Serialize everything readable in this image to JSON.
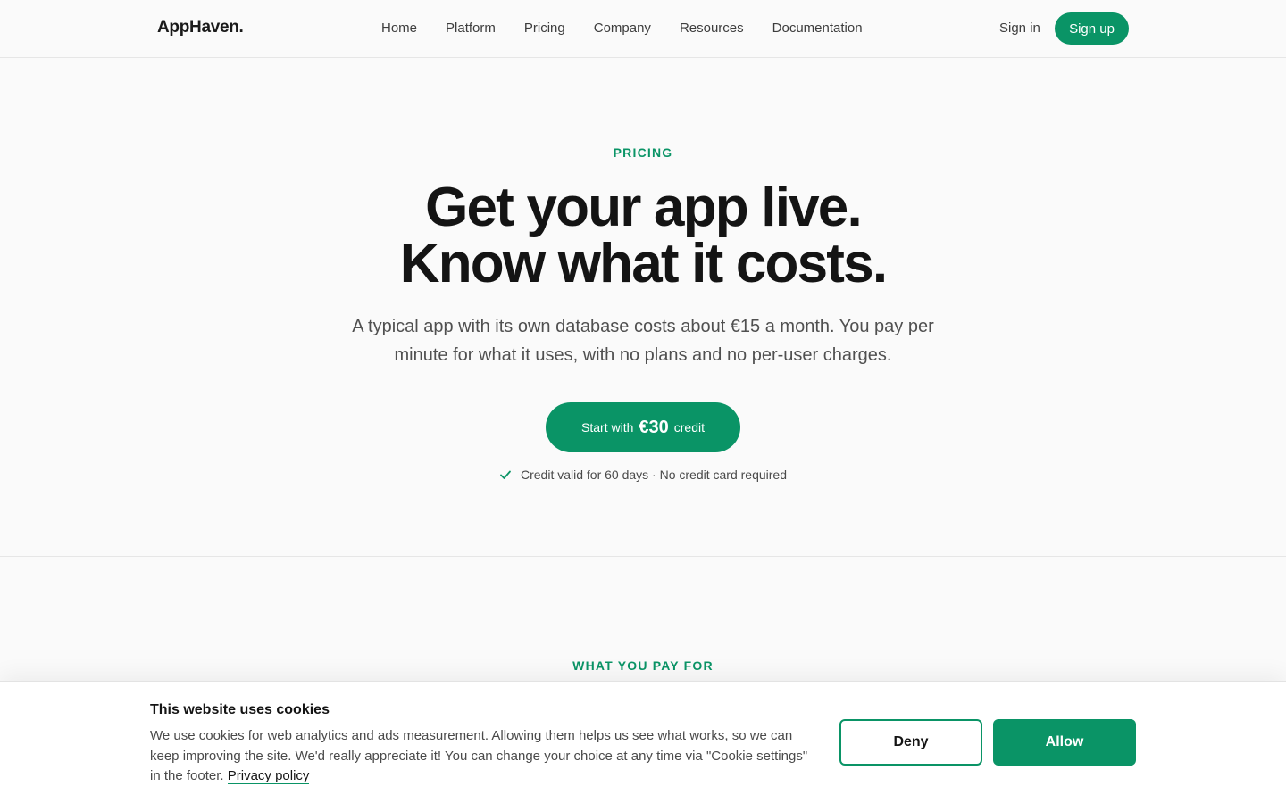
{
  "header": {
    "logo": "AppHaven.",
    "nav": [
      "Home",
      "Platform",
      "Pricing",
      "Company",
      "Resources",
      "Documentation"
    ],
    "sign_in": "Sign in",
    "sign_up": "Sign up"
  },
  "hero": {
    "eyebrow": "PRICING",
    "headline_line1": "Get your app live.",
    "headline_line2": "Know what it costs.",
    "subtext": "A typical app with its own database costs about €15 a month. You pay per minute for what it uses, with no plans and no per-user charges.",
    "cta_prefix": "Start with",
    "cta_amount": "€30",
    "cta_suffix": "credit",
    "note": "Credit valid for 60 days · No credit card required"
  },
  "section2": {
    "eyebrow": "WHAT YOU PAY FOR"
  },
  "cookie_banner": {
    "title": "This website uses cookies",
    "text": "We use cookies for web analytics and ads measurement. Allowing them helps us see what works, so we can keep improving the site. We'd really appreciate it! You can change your choice at any time via \"Cookie settings\" in the footer.",
    "privacy_link": "Privacy policy",
    "deny": "Deny",
    "allow": "Allow"
  },
  "colors": {
    "accent": "#0a9466",
    "background": "#fafafa",
    "text": "#141414"
  },
  "icons": {
    "note_icon": "check-icon"
  }
}
